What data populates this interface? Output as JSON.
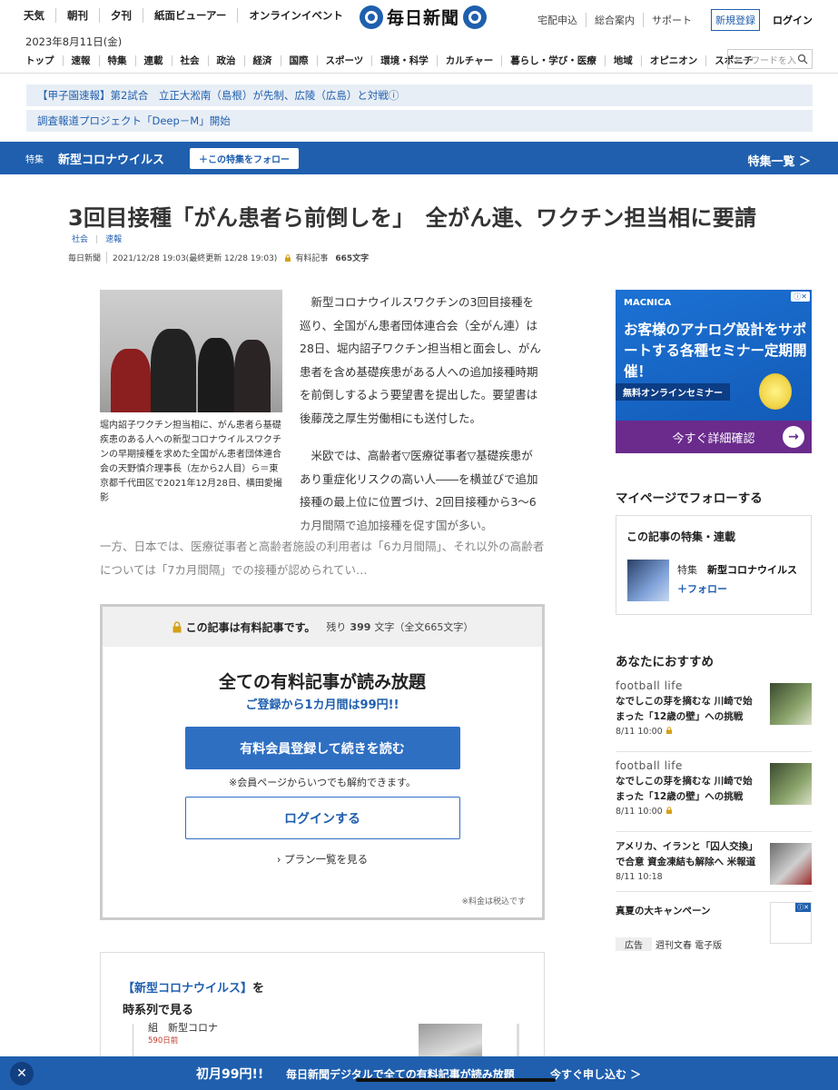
{
  "header": {
    "top_nav": [
      "天気",
      "朝刊",
      "夕刊",
      "紙面ビューアー",
      "オンラインイベント"
    ],
    "logo": "毎日新聞",
    "right_links": [
      "宅配申込",
      "総合案内",
      "サポート"
    ],
    "register": "新規登録",
    "login": "ログイン",
    "date": "2023年8月11日(金)",
    "main_nav": [
      "トップ",
      "速報",
      "特集",
      "連載",
      "社会",
      "政治",
      "経済",
      "国際",
      "スポーツ",
      "環境・科学",
      "カルチャー",
      "暮らし・学び・医療",
      "地域",
      "オピニオン",
      "スポニチ"
    ],
    "search_placeholder": "キーワードを入",
    "notices": [
      "【甲子園速報】第2試合　立正大淞南（島根）が先制、広陵（広島）と対戦ⓘ",
      "調査報道プロジェクト「Deep－M」開始"
    ]
  },
  "special": {
    "label": "特集",
    "title": "新型コロナウイルス",
    "follow": "＋この特集をフォロー",
    "list": "特集一覧 ＞"
  },
  "article": {
    "title": "3回目接種「がん患者ら前倒しを」　全がん連、ワクチン担当相に要請",
    "tags": [
      "社会",
      "速報"
    ],
    "source": "毎日新聞",
    "date": "2021/12/28 19:03(最終更新 12/28 19:03)",
    "paid": "有料記事",
    "chars": "665文字",
    "caption": "堀内詔子ワクチン担当相に、がん患者ら基礎疾患のある人への新型コロナウイルスワクチンの早期接種を求めた全国がん患者団体連合会の天野慎介理事長（左から2人目）ら＝東京都千代田区で2021年12月28日、横田愛撮影",
    "p1": "新型コロナウイルスワクチンの3回目接種を巡り、全国がん患者団体連合会（全がん連）は28日、堀内詔子ワクチン担当相と面会し、がん患者を含め基礎疾患がある人への追加接種時期を前倒しするよう要望書を提出した。要望書は後藤茂之厚生労働相にも送付した。",
    "p2": "米欧では、高齢者▽医療従事者▽基礎疾患があり重症化リスクの高い人――を横並びで追加接種の最上位に位置づけ、2回目接種から3～6カ月間隔で追加接種を促す国が多い。",
    "p3": "一方、日本では、医療従事者と高齢者施設の利用者は「6カ月間隔」、それ以外の高齢者については「7カ月間隔」での接種が認められてい…"
  },
  "paywall": {
    "head": "この記事は有料記事です。",
    "remain_prefix": "残り",
    "remain_num": "399",
    "remain_suffix": "文字（全文665文字）",
    "title": "全ての有料記事が読み放題",
    "sub": "ご登録から1カ月間は99円!!",
    "register_btn": "有料会員登録して続きを読む",
    "note": "※会員ページからいつでも解約できます。",
    "login_btn": "ログインする",
    "plans": "› プラン一覧を見る",
    "tax": "※料金は税込です"
  },
  "timeline": {
    "topic": "【新型コロナウイルス】",
    "suffix": "を",
    "line2": "時系列で見る",
    "item_title": "組　新型コロナ",
    "item_time": "590日前"
  },
  "sidebar": {
    "ad": {
      "brand": "MACNICA",
      "text": "お客様のアナログ設計をサポートする各種セミナー定期開催！",
      "seminar": "無料オンラインセミナー",
      "cta": "今すぐ詳細確認",
      "arrow": "→"
    },
    "mypage_heading": "マイページでフォローする",
    "follow_box_title": "この記事の特集・連載",
    "follow_label": "特集",
    "follow_name": "新型コロナウイルス",
    "follow_btn": "＋フォロー",
    "recommend_heading": "あなたにおすすめ",
    "recommend": [
      {
        "source": "football life",
        "headline": "なでしこの芽を摘むな 川崎で始まった「12歳の壁」への挑戦",
        "time": "8/11 10:00"
      },
      {
        "source": "football life",
        "headline": "なでしこの芽を摘むな 川崎で始まった「12歳の壁」への挑戦",
        "time": "8/11 10:00"
      },
      {
        "source": "",
        "headline": "アメリカ、イランと「囚人交換」で合意 資金凍結も解除へ 米報道",
        "time": "8/11 10:18"
      }
    ],
    "ad2_label": "真夏の大キャンペーン",
    "ad2_foot": [
      "広告",
      "週刊文春 電子版"
    ]
  },
  "bottom": {
    "close": "✕",
    "t1": "初月99円!!",
    "t2": "毎日新聞デジタルで全ての有料記事が読み放題",
    "t3": "今すぐ申し込む ＞"
  }
}
